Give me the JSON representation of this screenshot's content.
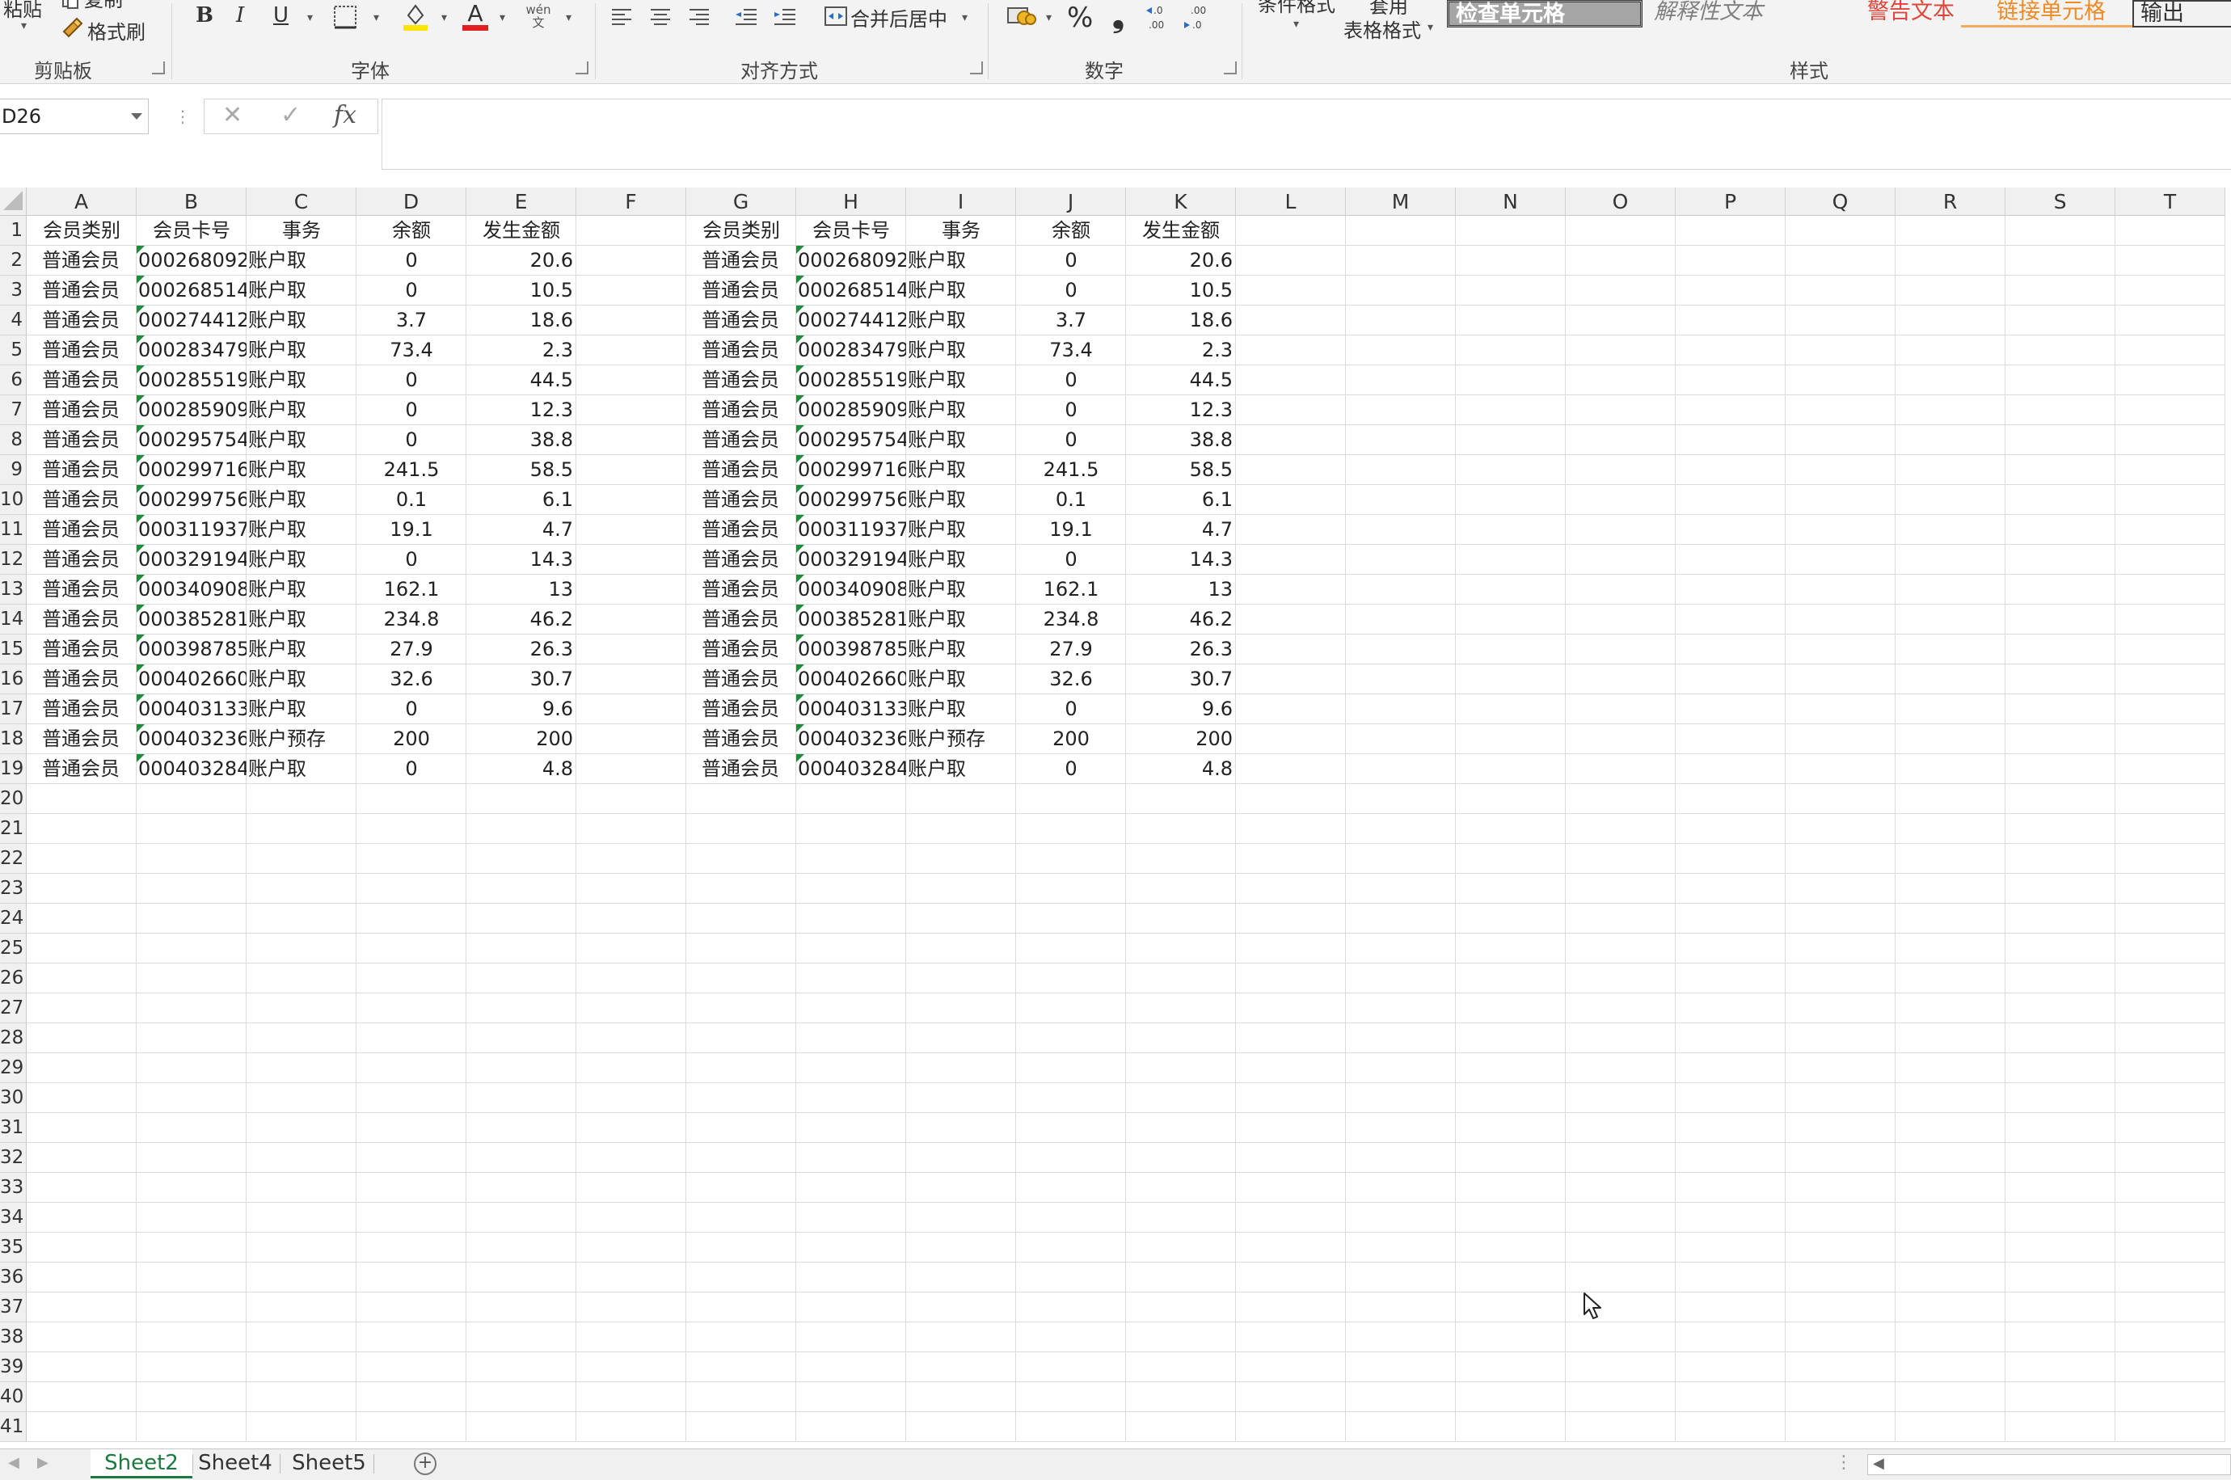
{
  "ribbon": {
    "clipboard": {
      "paste": "粘贴",
      "copy": "复制",
      "format_painter": "格式刷",
      "group": "剪贴板"
    },
    "font": {
      "group": "字体",
      "bold": "B",
      "italic": "I",
      "underline": "U",
      "font_color_letter": "A",
      "phonetic_top": "wén",
      "phonetic_bottom": "文"
    },
    "alignment": {
      "group": "对齐方式",
      "merge_center": "合并后居中"
    },
    "number": {
      "group": "数字",
      "percent": "%",
      "comma": "❟",
      "inc_decimal": ".0\n.00",
      "dec_decimal": ".00\n.0"
    },
    "styles": {
      "group": "样式",
      "conditional_format": "条件格式",
      "table_format_top": "套用",
      "table_format_bottom": "表格格式",
      "check_cell": "检查单元格",
      "explanatory": "解释性文本",
      "warning": "警告文本",
      "linked_cell": "链接单元格",
      "output": "输出"
    }
  },
  "formula_bar": {
    "name_box": "D26",
    "cancel": "✕",
    "enter": "✓",
    "fx": "fx",
    "value": ""
  },
  "columns": [
    "A",
    "B",
    "C",
    "D",
    "E",
    "F",
    "G",
    "H",
    "I",
    "J",
    "K",
    "L",
    "M",
    "N",
    "O",
    "P",
    "Q",
    "R",
    "S",
    "T"
  ],
  "row_numbers": [
    "1",
    "2",
    "3",
    "4",
    "5",
    "6",
    "7",
    "8",
    "9",
    "10",
    "11",
    "12",
    "13",
    "14",
    "15",
    "16",
    "17",
    "18",
    "19",
    "20",
    "21",
    "22",
    "23",
    "24",
    "25",
    "26",
    "27",
    "28",
    "29",
    "30",
    "31",
    "32",
    "33",
    "34",
    "35",
    "36",
    "37",
    "38",
    "39",
    "40",
    "41"
  ],
  "table_headers": [
    "会员类别",
    "会员卡号",
    "事务",
    "余额",
    "发生金额"
  ],
  "rows": [
    [
      "普通会员",
      "000268092",
      "账户取",
      "0",
      "20.6"
    ],
    [
      "普通会员",
      "000268514",
      "账户取",
      "0",
      "10.5"
    ],
    [
      "普通会员",
      "000274412",
      "账户取",
      "3.7",
      "18.6"
    ],
    [
      "普通会员",
      "000283479",
      "账户取",
      "73.4",
      "2.3"
    ],
    [
      "普通会员",
      "000285519",
      "账户取",
      "0",
      "44.5"
    ],
    [
      "普通会员",
      "000285909",
      "账户取",
      "0",
      "12.3"
    ],
    [
      "普通会员",
      "000295754",
      "账户取",
      "0",
      "38.8"
    ],
    [
      "普通会员",
      "000299716",
      "账户取",
      "241.5",
      "58.5"
    ],
    [
      "普通会员",
      "000299756",
      "账户取",
      "0.1",
      "6.1"
    ],
    [
      "普通会员",
      "000311937",
      "账户取",
      "19.1",
      "4.7"
    ],
    [
      "普通会员",
      "000329194",
      "账户取",
      "0",
      "14.3"
    ],
    [
      "普通会员",
      "000340908",
      "账户取",
      "162.1",
      "13"
    ],
    [
      "普通会员",
      "000385281",
      "账户取",
      "234.8",
      "46.2"
    ],
    [
      "普通会员",
      "000398785",
      "账户取",
      "27.9",
      "26.3"
    ],
    [
      "普通会员",
      "000402660",
      "账户取",
      "32.6",
      "30.7"
    ],
    [
      "普通会员",
      "000403133",
      "账户取",
      "0",
      "9.6"
    ],
    [
      "普通会员",
      "000403236",
      "账户预存",
      "200",
      "200"
    ],
    [
      "普通会员",
      "000403284",
      "账户取",
      "0",
      "4.8"
    ]
  ],
  "sheet_tabs": [
    "Sheet2",
    "Sheet4",
    "Sheet5"
  ],
  "active_sheet": "Sheet2",
  "colors": {
    "accent_green": "#1d7a3e",
    "warning_red": "#e0443a",
    "link_orange": "#f08a24",
    "font_color_red": "#e02020",
    "fill_yellow": "#ffe400"
  }
}
